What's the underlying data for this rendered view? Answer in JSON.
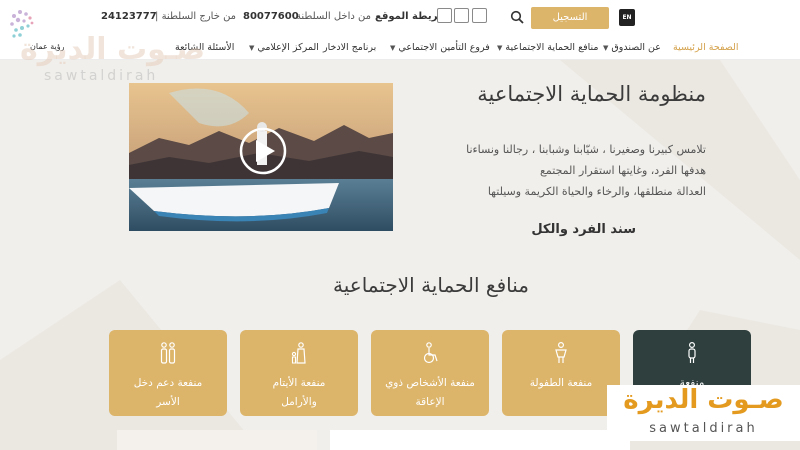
{
  "topbar": {
    "outside_label": "| من خارج السلطنة",
    "outside_number": "24123777",
    "inside_label": "من داخل السلطنة",
    "inside_number": "80077600",
    "sitemap": "خريطة الموقع",
    "register": "التسجيل",
    "lang_toggle": "EN"
  },
  "logo": {
    "text": "رؤية عمان"
  },
  "nav": {
    "items": [
      {
        "label": "الصفحة الرئيسية",
        "active": true
      },
      {
        "label": "عن الصندوق",
        "dropdown": true
      },
      {
        "label": "منافع الحماية الاجتماعية",
        "dropdown": true
      },
      {
        "label": "فروع التأمين الاجتماعي",
        "dropdown": true
      },
      {
        "label": "برنامج الادخار"
      },
      {
        "label": "المركز الإعلامي",
        "dropdown": true
      },
      {
        "label": "الأسئلة الشائعة"
      }
    ]
  },
  "hero": {
    "title": "منظومة الحماية الاجتماعية",
    "lines": [
      "تلامس كبيرنا وصغيرنا ، شيّابنا وشبابنا ، رجالنا ونساءنا",
      "هدفها الفرد، وغايتها استقرار المجتمع",
      "العدالة منطلقها، والرخاء والحياة الكريمة وسيلتها"
    ],
    "slogan": "سند الفرد والكل"
  },
  "benefits": {
    "title": "منافع الحماية الاجتماعية",
    "cards": [
      {
        "line1": "منفعة",
        "line2": "",
        "dark": true,
        "icon": "elderly-person-icon"
      },
      {
        "line1": "منفعة الطفولة",
        "line2": "",
        "dark": false,
        "icon": "child-icon"
      },
      {
        "line1": "منفعة الأشخاص ذوي",
        "line2": "الإعاقة",
        "dark": false,
        "icon": "wheelchair-icon"
      },
      {
        "line1": "منفعة الأيتام",
        "line2": "والأرامل",
        "dark": false,
        "icon": "widow-orphan-icon"
      },
      {
        "line1": "منفعة دعم دخل",
        "line2": "الأسر",
        "dark": false,
        "icon": "family-icon"
      }
    ]
  },
  "watermark": {
    "arabic": "صـوت الديرة",
    "latin": "sawtaldirah"
  },
  "colors": {
    "gold": "#dcb46a",
    "dark_card": "#2e3f3e",
    "background": "#f1efeb",
    "watermark_orange": "#e39a1f"
  }
}
